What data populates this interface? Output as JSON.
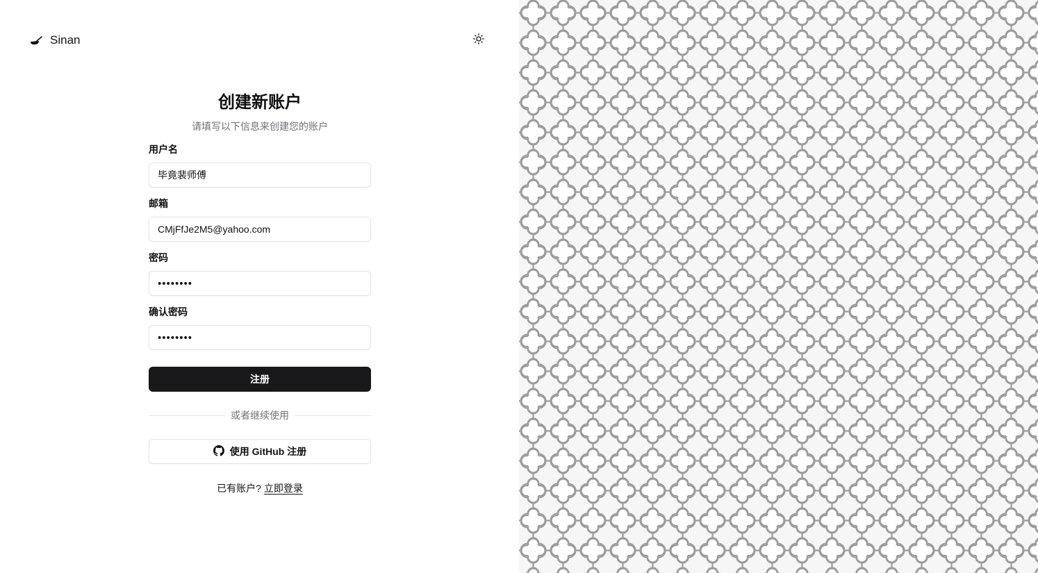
{
  "brand": {
    "name": "Sinan",
    "logo_icon": "spoon-icon"
  },
  "header": {
    "theme_icon": "sun-icon"
  },
  "form": {
    "title": "创建新账户",
    "subtitle": "请填写以下信息来创建您的账户",
    "username": {
      "label": "用户名",
      "value": "毕竟裴师傅"
    },
    "email": {
      "label": "邮箱",
      "value": "CMjFfJe2M5@yahoo.com"
    },
    "password": {
      "label": "密码",
      "value": "••••••••"
    },
    "confirm_password": {
      "label": "确认密码",
      "value": "••••••••"
    },
    "submit_label": "注册",
    "divider_text": "或者继续使用",
    "github_label": "使用 GitHub 注册",
    "footer_text": "已有账户?",
    "login_link": "立即登录"
  },
  "colors": {
    "primary": "#18181b",
    "muted": "#71717a",
    "border": "#e4e4e7",
    "pattern_stroke": "#9c9c9c"
  }
}
